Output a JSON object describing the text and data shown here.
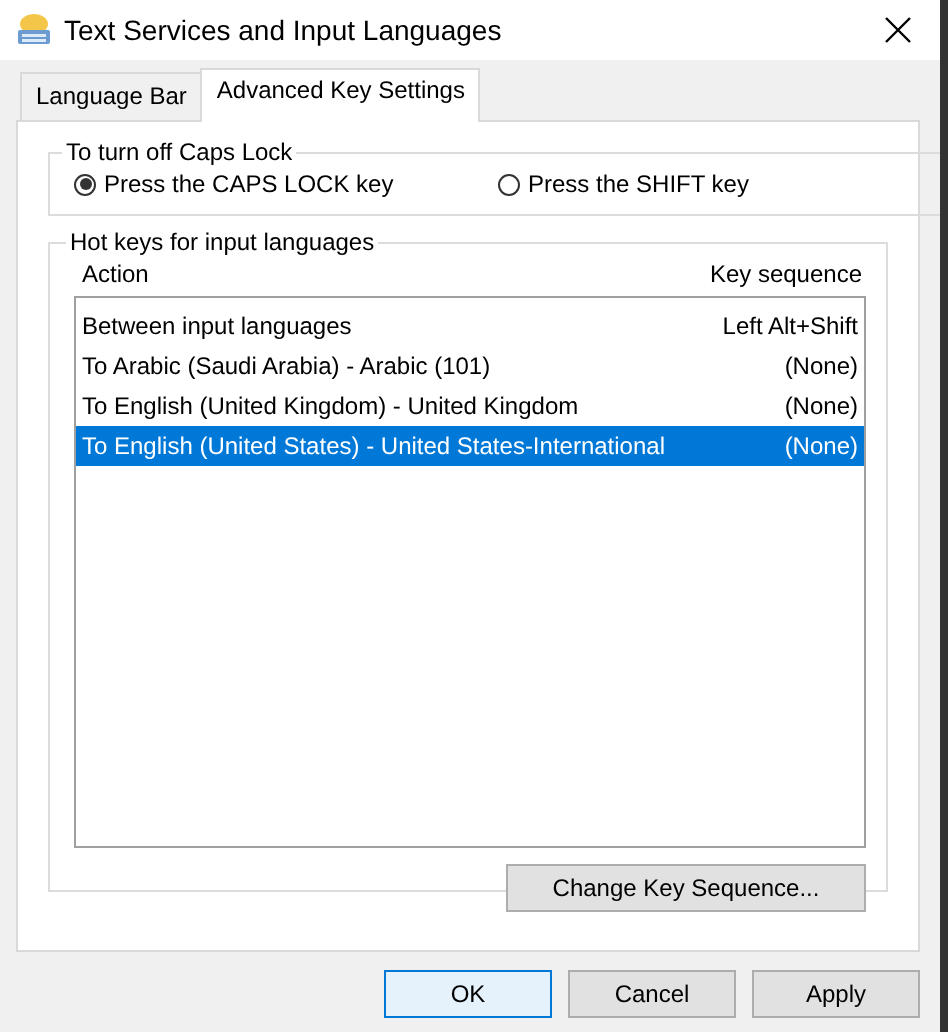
{
  "window": {
    "title": "Text Services and Input Languages"
  },
  "tabs": [
    {
      "label": "Language Bar",
      "selected": false
    },
    {
      "label": "Advanced Key Settings",
      "selected": true
    }
  ],
  "caps_lock": {
    "title": "To turn off Caps Lock",
    "options": [
      {
        "label": "Press the CAPS LOCK key",
        "selected": true
      },
      {
        "label": "Press the SHIFT key",
        "selected": false
      }
    ]
  },
  "hot_keys": {
    "title": "Hot keys for input languages",
    "columns": [
      "Action",
      "Key sequence"
    ],
    "rows": [
      {
        "action": "Between input languages",
        "sequence": "Left Alt+Shift",
        "selected": false
      },
      {
        "action": "To Arabic (Saudi Arabia) - Arabic (101)",
        "sequence": "(None)",
        "selected": false
      },
      {
        "action": "To English (United Kingdom) - United Kingdom",
        "sequence": "(None)",
        "selected": false
      },
      {
        "action": "To English (United States) - United States-International",
        "sequence": "(None)",
        "selected": true
      }
    ],
    "button": "Change Key Sequence..."
  },
  "buttons": [
    {
      "label": "OK",
      "default": true
    },
    {
      "label": "Cancel",
      "default": false
    },
    {
      "label": "Apply",
      "default": false
    }
  ]
}
